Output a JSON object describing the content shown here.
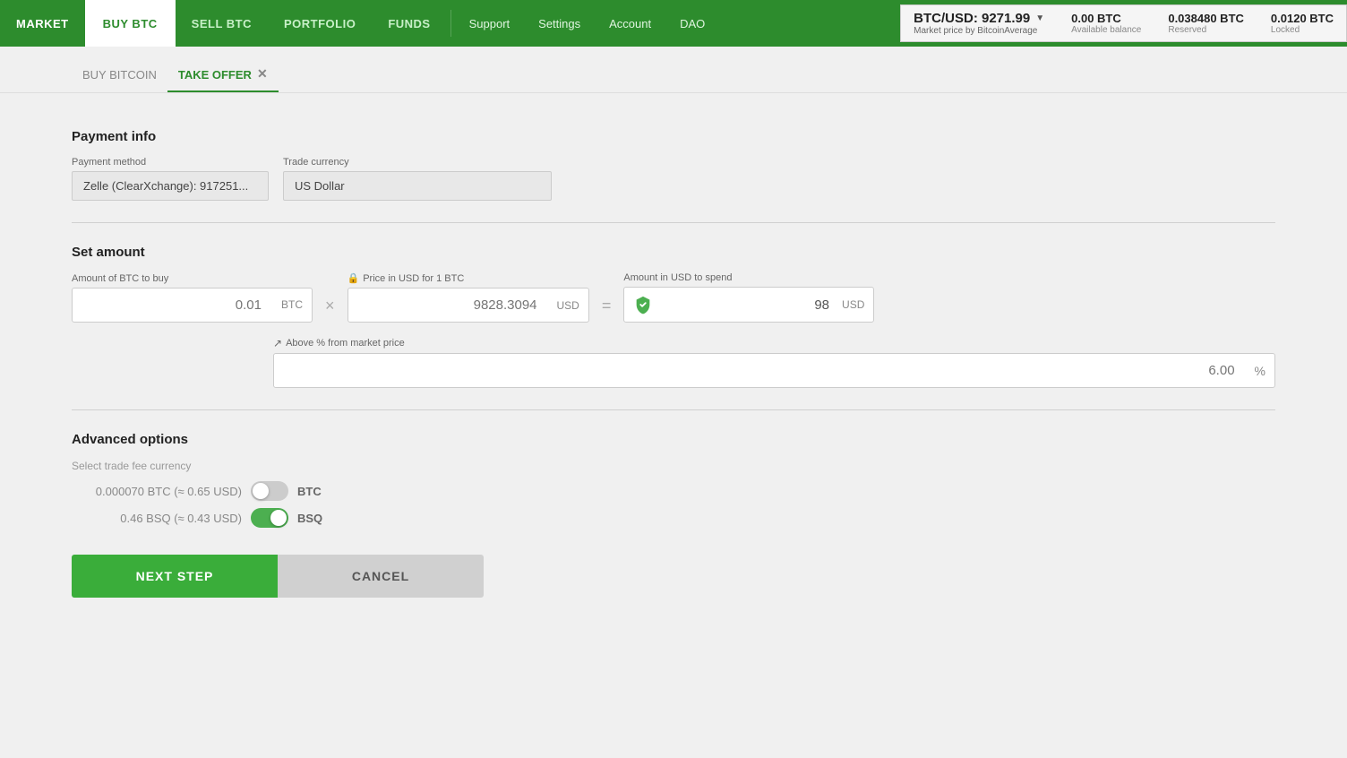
{
  "nav": {
    "items": [
      {
        "id": "market",
        "label": "MARKET",
        "active": false
      },
      {
        "id": "buy-btc",
        "label": "BUY BTC",
        "active": true
      },
      {
        "id": "sell-btc",
        "label": "SELL BTC",
        "active": false
      },
      {
        "id": "portfolio",
        "label": "PORTFOLIO",
        "active": false
      },
      {
        "id": "funds",
        "label": "FUNDS",
        "active": false
      }
    ],
    "secondary": [
      {
        "id": "support",
        "label": "Support"
      },
      {
        "id": "settings",
        "label": "Settings"
      },
      {
        "id": "account",
        "label": "Account"
      },
      {
        "id": "dao",
        "label": "DAO"
      }
    ]
  },
  "market_info": {
    "price_label": "BTC/USD: 9271.99",
    "price_source": "Market price by BitcoinAverage",
    "available_balance_value": "0.00 BTC",
    "available_balance_label": "Available balance",
    "reserved_value": "0.038480 BTC",
    "reserved_label": "Reserved",
    "locked_value": "0.0120 BTC",
    "locked_label": "Locked"
  },
  "tabs": [
    {
      "id": "buy-bitcoin",
      "label": "BUY BITCOIN",
      "active": false,
      "closable": false
    },
    {
      "id": "take-offer",
      "label": "TAKE OFFER",
      "active": true,
      "closable": true
    }
  ],
  "payment_info": {
    "section_title": "Payment info",
    "payment_method_label": "Payment method",
    "payment_method_value": "Zelle (ClearXchange): 917251...",
    "trade_currency_label": "Trade currency",
    "trade_currency_value": "US Dollar"
  },
  "set_amount": {
    "section_title": "Set amount",
    "btc_amount_label": "Amount of BTC to buy",
    "btc_amount_placeholder": "0.01",
    "btc_currency": "BTC",
    "price_label": "Price in USD for 1 BTC",
    "price_locked": true,
    "price_placeholder": "9828.3094",
    "price_currency": "USD",
    "result_label": "Amount in USD to spend",
    "result_value": "98",
    "result_currency": "USD",
    "pct_label": "Above % from market price",
    "pct_placeholder": "6.00",
    "pct_sign": "%",
    "multiply_sign": "×",
    "equals_sign": "="
  },
  "advanced_options": {
    "section_title": "Advanced options",
    "select_fee_label": "Select trade fee currency",
    "btc_fee_amount": "0.000070 BTC (≈ 0.65 USD)",
    "btc_fee_currency": "BTC",
    "btc_toggle_on": false,
    "bsq_fee_amount": "0.46 BSQ (≈ 0.43 USD)",
    "bsq_fee_currency": "BSQ",
    "bsq_toggle_on": true
  },
  "buttons": {
    "next_step": "NEXT STEP",
    "cancel": "CANCEL"
  }
}
